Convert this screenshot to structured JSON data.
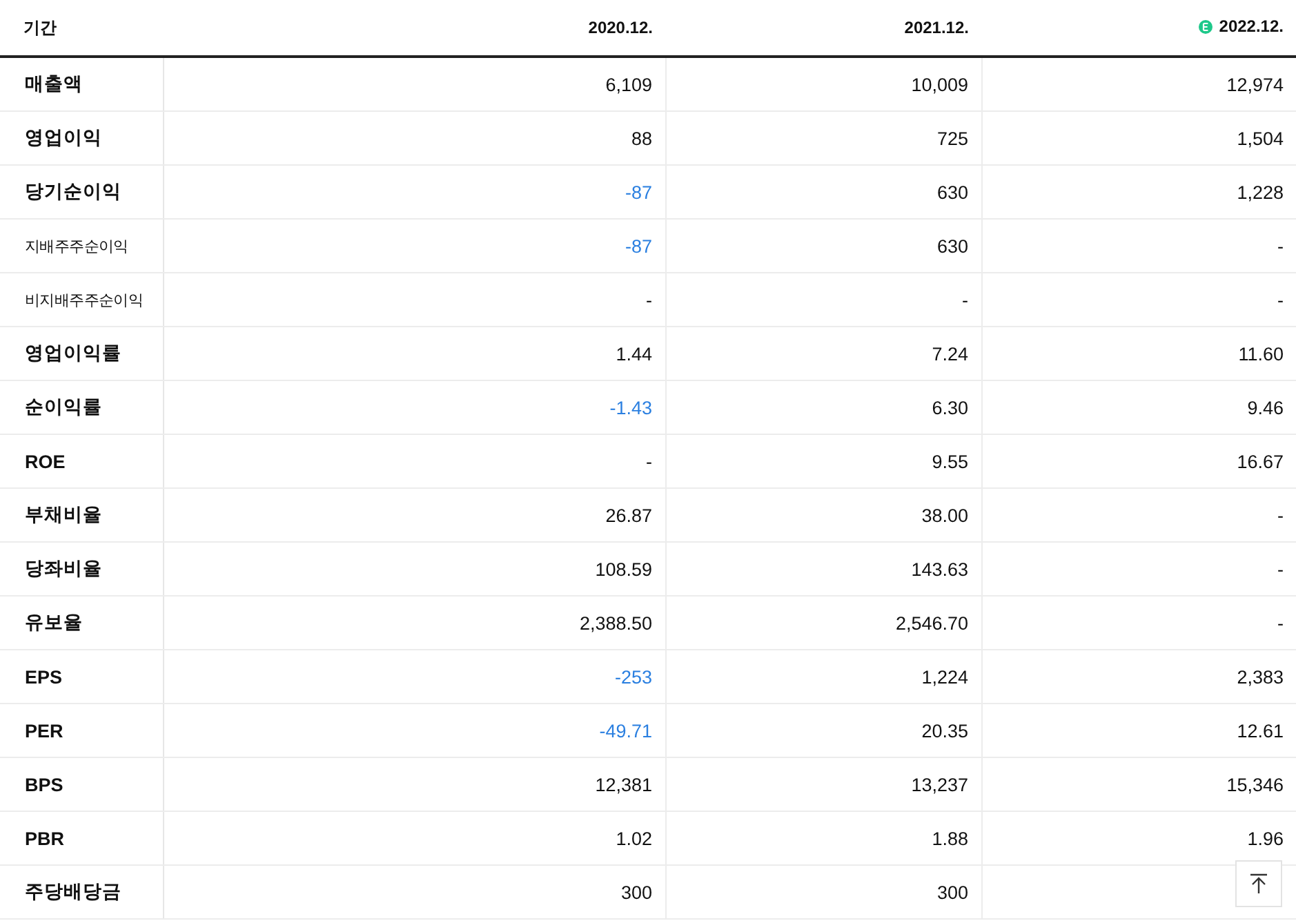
{
  "table": {
    "period_label": "기간",
    "columns": [
      {
        "label": "2020.12.",
        "estimate": false
      },
      {
        "label": "2021.12.",
        "estimate": false
      },
      {
        "label": "2022.12.",
        "estimate": true
      }
    ],
    "groups": [
      {
        "rows": [
          {
            "label": "매출액",
            "small": false,
            "cells": [
              {
                "text": "6,109",
                "negative": false
              },
              {
                "text": "10,009",
                "negative": false
              },
              {
                "text": "12,974",
                "negative": false
              }
            ]
          },
          {
            "label": "영업이익",
            "small": false,
            "cells": [
              {
                "text": "88",
                "negative": false
              },
              {
                "text": "725",
                "negative": false
              },
              {
                "text": "1,504",
                "negative": false
              }
            ]
          },
          {
            "label": "당기순이익",
            "small": false,
            "cells": [
              {
                "text": "-87",
                "negative": true
              },
              {
                "text": "630",
                "negative": false
              },
              {
                "text": "1,228",
                "negative": false
              }
            ]
          },
          {
            "label": "지배주주순이익",
            "small": true,
            "cells": [
              {
                "text": "-87",
                "negative": true
              },
              {
                "text": "630",
                "negative": false
              },
              {
                "text": "-",
                "negative": false
              }
            ]
          },
          {
            "label": "비지배주주순이익",
            "small": true,
            "cells": [
              {
                "text": "-",
                "negative": false
              },
              {
                "text": "-",
                "negative": false
              },
              {
                "text": "-",
                "negative": false
              }
            ]
          }
        ]
      },
      {
        "rows": [
          {
            "label": "영업이익률",
            "small": false,
            "cells": [
              {
                "text": "1.44",
                "negative": false
              },
              {
                "text": "7.24",
                "negative": false
              },
              {
                "text": "11.60",
                "negative": false
              }
            ]
          },
          {
            "label": "순이익률",
            "small": false,
            "cells": [
              {
                "text": "-1.43",
                "negative": true
              },
              {
                "text": "6.30",
                "negative": false
              },
              {
                "text": "9.46",
                "negative": false
              }
            ]
          },
          {
            "label": "ROE",
            "small": false,
            "cells": [
              {
                "text": "-",
                "negative": false
              },
              {
                "text": "9.55",
                "negative": false
              },
              {
                "text": "16.67",
                "negative": false
              }
            ]
          }
        ]
      },
      {
        "rows": [
          {
            "label": "부채비율",
            "small": false,
            "cells": [
              {
                "text": "26.87",
                "negative": false
              },
              {
                "text": "38.00",
                "negative": false
              },
              {
                "text": "-",
                "negative": false
              }
            ]
          },
          {
            "label": "당좌비율",
            "small": false,
            "cells": [
              {
                "text": "108.59",
                "negative": false
              },
              {
                "text": "143.63",
                "negative": false
              },
              {
                "text": "-",
                "negative": false
              }
            ]
          },
          {
            "label": "유보율",
            "small": false,
            "cells": [
              {
                "text": "2,388.50",
                "negative": false
              },
              {
                "text": "2,546.70",
                "negative": false
              },
              {
                "text": "-",
                "negative": false
              }
            ]
          }
        ]
      },
      {
        "rows": [
          {
            "label": "EPS",
            "small": false,
            "cells": [
              {
                "text": "-253",
                "negative": true
              },
              {
                "text": "1,224",
                "negative": false
              },
              {
                "text": "2,383",
                "negative": false
              }
            ]
          },
          {
            "label": "PER",
            "small": false,
            "cells": [
              {
                "text": "-49.71",
                "negative": true
              },
              {
                "text": "20.35",
                "negative": false
              },
              {
                "text": "12.61",
                "negative": false
              }
            ]
          },
          {
            "label": "BPS",
            "small": false,
            "cells": [
              {
                "text": "12,381",
                "negative": false
              },
              {
                "text": "13,237",
                "negative": false
              },
              {
                "text": "15,346",
                "negative": false
              }
            ]
          },
          {
            "label": "PBR",
            "small": false,
            "cells": [
              {
                "text": "1.02",
                "negative": false
              },
              {
                "text": "1.88",
                "negative": false
              },
              {
                "text": "1.96",
                "negative": false
              }
            ]
          }
        ]
      },
      {
        "rows": [
          {
            "label": "주당배당금",
            "small": false,
            "cells": [
              {
                "text": "300",
                "negative": false
              },
              {
                "text": "300",
                "negative": false
              }
            ]
          }
        ]
      }
    ]
  }
}
